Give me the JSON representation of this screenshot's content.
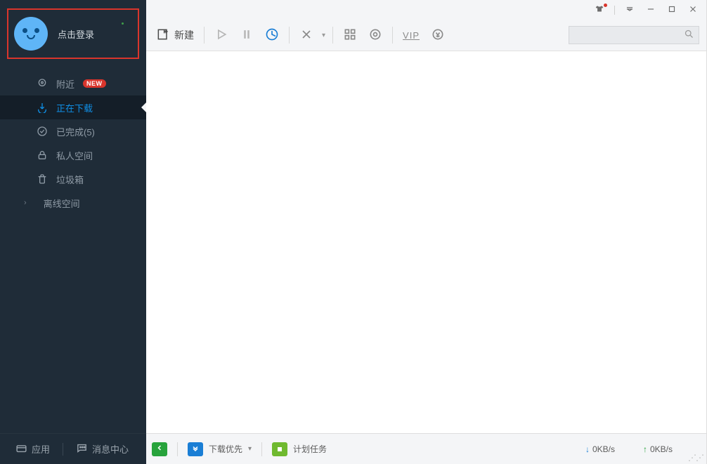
{
  "profile": {
    "login_label": "点击登录"
  },
  "sidebar": {
    "nearby": {
      "label": "附近",
      "badge": "NEW"
    },
    "downloading": {
      "label": "正在下载"
    },
    "completed": {
      "label": "已完成(5)"
    },
    "private": {
      "label": "私人空间"
    },
    "trash": {
      "label": "垃圾箱"
    },
    "offline": {
      "label": "离线空间"
    }
  },
  "sidebar_footer": {
    "apps": "应用",
    "messages": "消息中心"
  },
  "toolbar": {
    "new": "新建"
  },
  "search": {
    "placeholder": ""
  },
  "status": {
    "priority": "下载优先",
    "scheduled": "计划任务",
    "down_speed": "0KB/s",
    "up_speed": "0KB/s"
  }
}
